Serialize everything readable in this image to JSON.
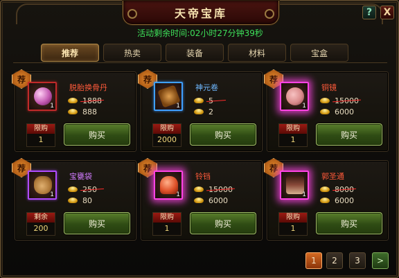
{
  "window": {
    "title": "天帝宝库",
    "help_label": "?",
    "close_label": "X"
  },
  "timer_text": "活动剩余时间:02小时27分钟39秒",
  "tabs": [
    {
      "label": "推荐",
      "active": true
    },
    {
      "label": "热卖",
      "active": false
    },
    {
      "label": "装备",
      "active": false
    },
    {
      "label": "材料",
      "active": false
    },
    {
      "label": "宝盒",
      "active": false
    }
  ],
  "rec_badge": "荐",
  "buy_label": "购买",
  "items": [
    {
      "name": "脱胎换骨丹",
      "count": "1",
      "original_price": "1888",
      "price": "888",
      "limit_label": "限购",
      "limit_value": "1",
      "frame": "red",
      "icon": "pink-pearl-pill-icon",
      "icon_color": "#c35ab2"
    },
    {
      "name": "神元卷",
      "count": "1",
      "original_price": "5",
      "price": "2",
      "limit_label": "限购",
      "limit_value": "2000",
      "frame": "blue",
      "icon": "scroll-icon",
      "icon_color": "#b0702a"
    },
    {
      "name": "铜镜",
      "count": "1",
      "original_price": "15000",
      "price": "6000",
      "limit_label": "限购",
      "limit_value": "1",
      "frame": "pink",
      "icon": "bronze-mirror-icon",
      "icon_color": "#d98a8a"
    },
    {
      "name": "宝甕袋",
      "count": "1",
      "original_price": "250",
      "price": "80",
      "limit_label": "剩余",
      "limit_value": "200",
      "frame": "purple",
      "icon": "treasure-bag-icon",
      "icon_color": "#b07a3a"
    },
    {
      "name": "铃铛",
      "count": "1",
      "original_price": "15000",
      "price": "6000",
      "limit_label": "限购",
      "limit_value": "1",
      "frame": "pink",
      "icon": "bell-icon",
      "icon_color": "#e0522a"
    },
    {
      "name": "郭圣通",
      "count": "1",
      "original_price": "8000",
      "price": "6000",
      "limit_label": "限购",
      "limit_value": "1",
      "frame": "pink",
      "icon": "portrait-icon",
      "icon_color": "#8a4a3a"
    }
  ],
  "pagination": {
    "pages": [
      "1",
      "2",
      "3"
    ],
    "current": "1",
    "next_label": ">"
  },
  "colors": {
    "timer": "#3ee05a",
    "price_strike": "#ff2b2b",
    "item_name_red": "#ff5a3a",
    "item_name_purple": "#d27cff",
    "item_name_blue": "#6fb8ff",
    "limit_value": "#f1d77a"
  }
}
